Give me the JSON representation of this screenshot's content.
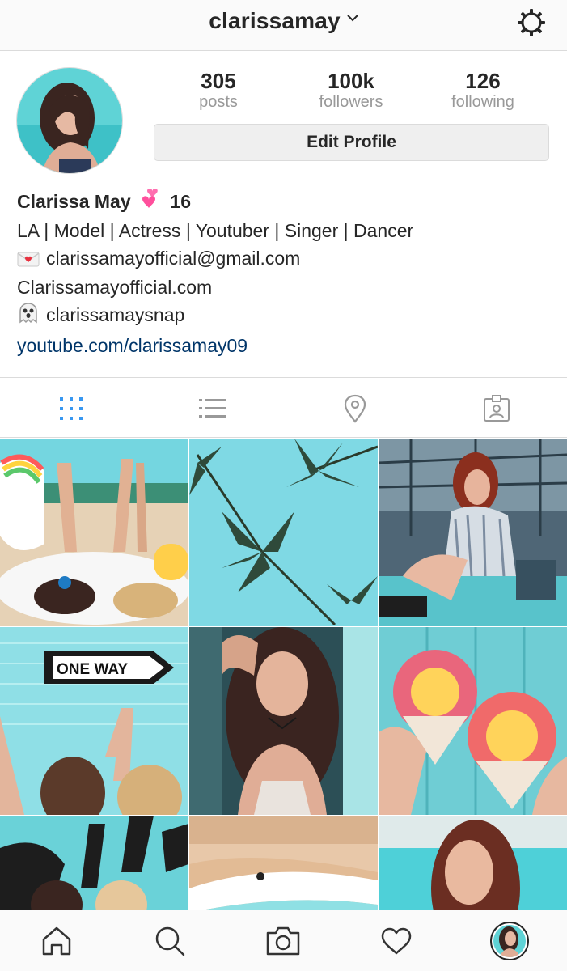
{
  "header": {
    "username": "clarissamay",
    "dropdown_icon": "chevron-down-icon",
    "settings_icon": "gear-icon"
  },
  "profile": {
    "stats": [
      {
        "value": "305",
        "label": "posts"
      },
      {
        "value": "100k",
        "label": "followers"
      },
      {
        "value": "126",
        "label": "following"
      }
    ],
    "edit_button_label": "Edit Profile"
  },
  "bio": {
    "name": "Clarissa May",
    "name_emoji": "two-hearts-emoji",
    "name_suffix": "16",
    "tagline": "LA | Model | Actress | Youtuber | Singer | Dancer",
    "email": "clarissamayofficial@gmail.com",
    "email_emoji": "love-letter-emoji",
    "website": "Clarissamayofficial.com",
    "snapchat": "clarissamaysnap",
    "snapchat_emoji": "ghost-emoji",
    "link": "youtube.com/clarissamay09"
  },
  "tabs": [
    {
      "name": "grid-view-icon",
      "active": true
    },
    {
      "name": "list-view-icon",
      "active": false
    },
    {
      "name": "map-pin-icon",
      "active": false
    },
    {
      "name": "tagged-photos-icon",
      "active": false
    }
  ],
  "grid_signs": {
    "one_way": "ONE WAY"
  },
  "bottom_nav": [
    {
      "name": "home-icon"
    },
    {
      "name": "search-icon"
    },
    {
      "name": "camera-icon"
    },
    {
      "name": "heart-icon"
    },
    {
      "name": "profile-avatar-icon"
    }
  ],
  "colors": {
    "accent_blue": "#3897f0",
    "link_blue": "#003569",
    "muted_gray": "#999999",
    "text_dark": "#262626"
  }
}
